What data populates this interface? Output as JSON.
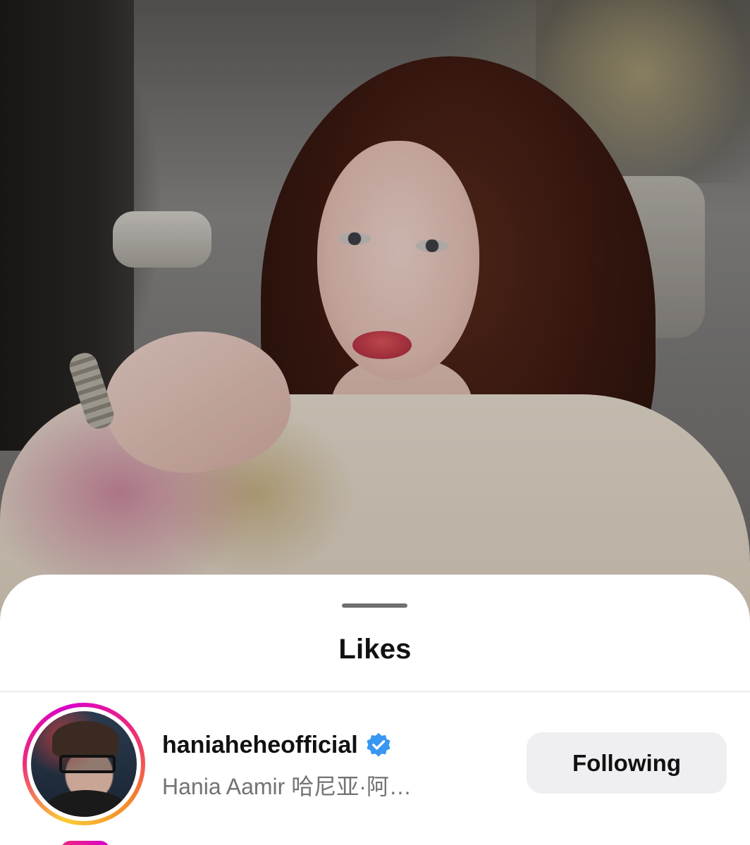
{
  "sheet": {
    "title": "Likes"
  },
  "likes": [
    {
      "username": "haniaheheofficial",
      "full_name": "Hania Aamir 哈尼亚·阿…",
      "verified": true,
      "button_label": "Following"
    }
  ],
  "colors": {
    "verified_badge": "#3897f0",
    "button_bg": "#efeff2",
    "secondary_text": "#737373",
    "story_ring": [
      "#f9ce34",
      "#ee2a7b",
      "#d800c9"
    ]
  },
  "icons": {
    "verified": "verified-badge-icon",
    "grabber": "sheet-grabber"
  }
}
